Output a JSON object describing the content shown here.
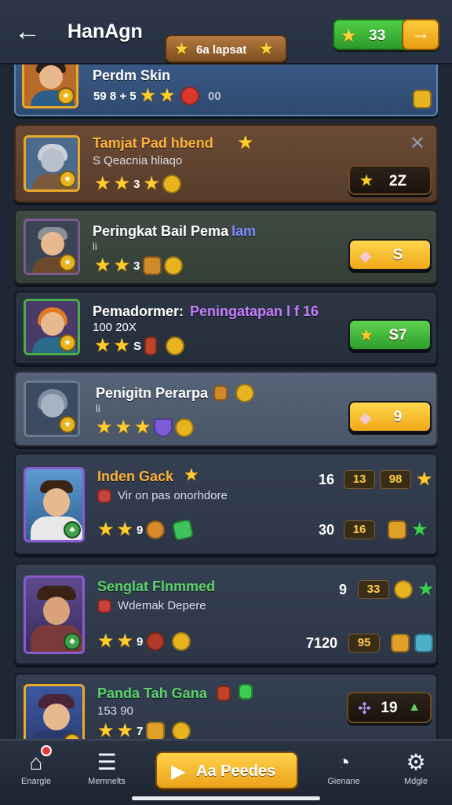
{
  "header": {
    "back_icon": "back-arrow-icon",
    "title": "HanAgn",
    "coins": "33",
    "ribbon": "6a lapsat"
  },
  "cards": [
    {
      "name": "Perdm Skin",
      "sub": "",
      "stars_text": "59 8 + 5",
      "extra": "00",
      "name_color": "#ffffff"
    },
    {
      "name": "Tamjat Pad hbend",
      "sub": "S Qeacnia hliaqo",
      "stars_text": "3",
      "button": "2Z",
      "name_color": "#ffb13b"
    },
    {
      "name": "Peringkat Bail Pema",
      "name2": "lam",
      "sub": "li",
      "stars_text": "3",
      "button": "S",
      "name_color": "#ffffff"
    },
    {
      "name": "Pemadormer:",
      "name2": "Peningatapan l f 16",
      "sub": "100 20X",
      "stars_text": "S",
      "button": "S7",
      "name_color": "#ffffff"
    },
    {
      "name": "Penigitn Perarpa",
      "sub": "li",
      "stars_text": "",
      "button": "9",
      "name_color": "#ffffff"
    },
    {
      "name": "Inden Gack",
      "sub": "Vir on pas onorhdore",
      "stars_text": "9",
      "stats_top": [
        "16",
        "13",
        "98"
      ],
      "stats_bottom": [
        "30",
        "16"
      ],
      "name_color": "#ffb13b"
    },
    {
      "name": "Senglat Flnmmed",
      "sub": "Wdemak Depere",
      "stars_text": "9",
      "stats_top": [
        "9",
        "33"
      ],
      "stats_bottom": [
        "7120",
        "95"
      ],
      "name_color": "#5ed36a"
    },
    {
      "name": "Panda Tah Gana",
      "sub": "153 90",
      "stars_text": "7",
      "button": "19",
      "name_color": "#5ed36a"
    }
  ],
  "nav": {
    "items": [
      {
        "label": "Enargle",
        "icon": "home-icon"
      },
      {
        "label": "Memnelts",
        "icon": "list-icon"
      },
      {
        "label": "Gienane",
        "icon": "gauge-icon"
      },
      {
        "label": "Mdgle",
        "icon": "gear-icon"
      }
    ],
    "play_label": "Aa Peedes"
  }
}
